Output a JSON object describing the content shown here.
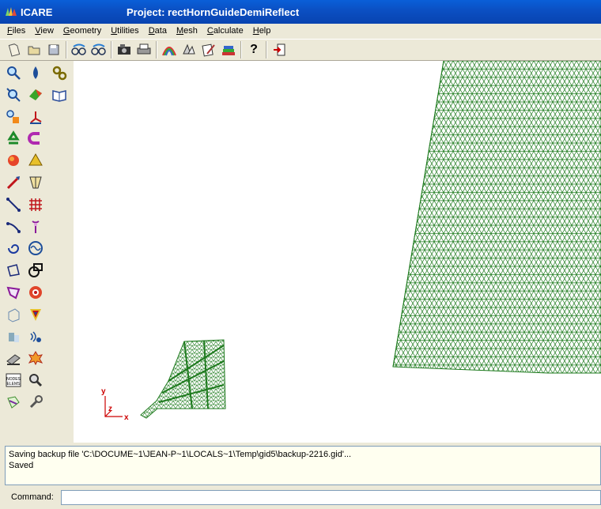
{
  "titlebar": {
    "app_name": "ICARE",
    "title": "Project: rectHornGuideDemiReflect"
  },
  "menu": [
    {
      "pre": "",
      "ul": "F",
      "post": "iles"
    },
    {
      "pre": "",
      "ul": "V",
      "post": "iew"
    },
    {
      "pre": "",
      "ul": "G",
      "post": "eometry"
    },
    {
      "pre": "",
      "ul": "U",
      "post": "tilities"
    },
    {
      "pre": "",
      "ul": "D",
      "post": "ata"
    },
    {
      "pre": "",
      "ul": "M",
      "post": "esh"
    },
    {
      "pre": "",
      "ul": "C",
      "post": "alculate"
    },
    {
      "pre": "",
      "ul": "H",
      "post": "elp"
    }
  ],
  "toolbar": {
    "icons": [
      "new-file-icon",
      "open-folder-icon",
      "save-disk-icon",
      "zoom-in-icon",
      "zoom-out-icon",
      "render-icon",
      "print-icon",
      "mesh-view-icon",
      "layers-icon",
      "notes-icon",
      "books-icon",
      "help-question-icon",
      "exit-icon"
    ],
    "help_label": "?"
  },
  "palette": {
    "left": [
      "zoom-region-icon",
      "zoom-frame-icon",
      "point-icon",
      "recycle-icon",
      "sphere-icon",
      "line-pointer-icon",
      "straight-line-icon",
      "arc-icon",
      "spiral-icon",
      "polygon-icon",
      "surface-icon",
      "volume-cube-icon",
      "cylinder-icon",
      "eraser-icon",
      "nodes-elems-icon",
      "mesh-hand-icon"
    ],
    "right": [
      "drop-icon",
      "surface-color-icon",
      "axes-icon",
      "magnet-icon",
      "pyramid-icon",
      "cylinder-cut-icon",
      "grid-mesh-icon",
      "antenna-icon",
      "wave-icon",
      "wire-icon",
      "target-icon",
      "shield-icon",
      "signal-icon",
      "burst-icon",
      "search-icon",
      "wrench-icon"
    ],
    "top": [
      "gears-icon",
      "book-icon"
    ],
    "nodes_label": "NODES ELEMS"
  },
  "canvas": {
    "axis_x": "x",
    "axis_y": "y",
    "axis_z": "z"
  },
  "messages": [
    "Saving backup file 'C:\\DOCUME~1\\JEAN-P~1\\LOCALS~1\\Temp\\gid5\\backup-2216.gid'...",
    "Saved"
  ],
  "command": {
    "label": "Command:",
    "value": ""
  },
  "colors": {
    "mesh": "#1d7a1d",
    "axis": "#cc0000",
    "title_bg": "#0b4fc2"
  }
}
